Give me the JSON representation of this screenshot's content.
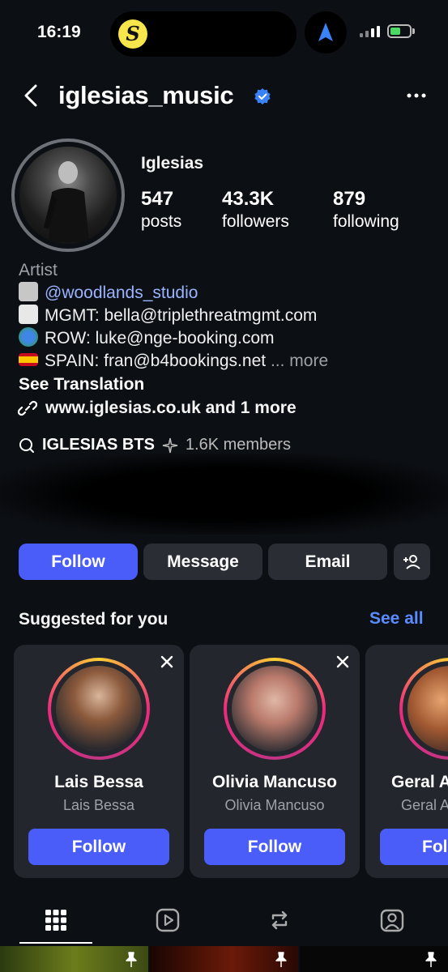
{
  "status_bar": {
    "time": "16:19"
  },
  "header": {
    "username": "iglesias_music"
  },
  "profile": {
    "display_name": "Iglesias",
    "stats": [
      {
        "value": "547",
        "label": "posts"
      },
      {
        "value": "43.3K",
        "label": "followers"
      },
      {
        "value": "879",
        "label": "following"
      }
    ],
    "category": "Artist",
    "bio": {
      "mention": "@woodlands_studio",
      "mgmt": "MGMT: bella@triplethreatmgmt.com",
      "row": "ROW: luke@nge-booking.com",
      "spain": "SPAIN: fran@b4bookings.net",
      "more": "... more",
      "see_translation": "See Translation"
    },
    "link": "www.iglesias.co.uk and 1 more",
    "channel": {
      "name": "IGLESIAS BTS",
      "members": "1.6K members"
    }
  },
  "actions": {
    "follow": "Follow",
    "message": "Message",
    "email": "Email"
  },
  "suggested": {
    "title": "Suggested for you",
    "see_all": "See all",
    "cards": [
      {
        "name": "Lais Bessa",
        "subtitle": "Lais Bessa",
        "button": "Follow"
      },
      {
        "name": "Olivia Mancuso",
        "subtitle": "Olivia Mancuso",
        "button": "Follow"
      },
      {
        "name": "Geral A",
        "subtitle": "Geral A",
        "button": "Fol"
      }
    ]
  },
  "colors": {
    "accent": "#4a5df9",
    "link": "#5b8cff",
    "background": "#0c0f14",
    "card": "#23262c"
  }
}
